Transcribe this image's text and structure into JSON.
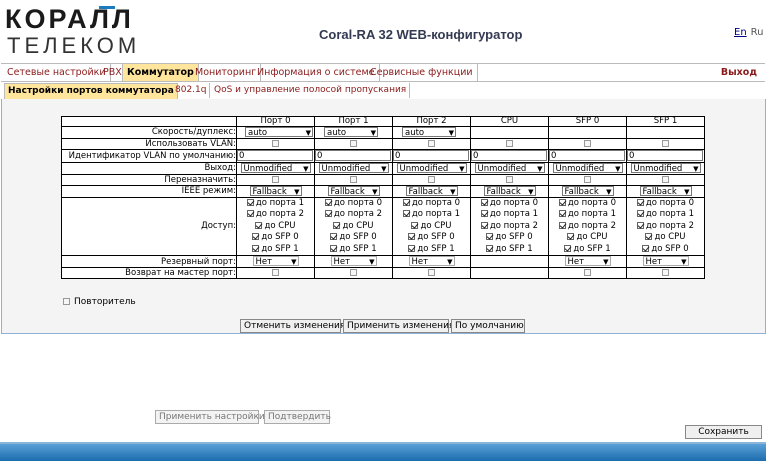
{
  "logo": {
    "line1": "КОРАЛЛ",
    "line2": "ТЕЛЕКОМ"
  },
  "header": {
    "title": "Coral-RA 32 WEB-конфигуратор",
    "lang_en": "En",
    "lang_ru": "Ru"
  },
  "menu": {
    "items": [
      "Сетевые настройки",
      "PBX",
      "Коммутатор",
      "Мониторинг",
      "Информация о системе",
      "Сервисные функции"
    ],
    "exit": "Выход"
  },
  "subtabs": [
    "Настройки портов коммутатора",
    "802.1q",
    "QoS и управление полосой пропускания"
  ],
  "table": {
    "columns": [
      "Порт 0",
      "Порт 1",
      "Порт 2",
      "CPU",
      "SFP 0",
      "SFP 1"
    ],
    "labels": {
      "speed": "Скорость/дуплекс:",
      "use_vlan": "Использовать VLAN:",
      "vlan_id": "Идентификатор VLAN по умолчанию:",
      "egress": "Выход:",
      "reassign": "Переназначить:",
      "ieee": "IEEE режим:",
      "access": "Доступ:",
      "backup": "Резервный порт:",
      "return_master": "Возврат на мастер порт:"
    },
    "speed_values": [
      "auto",
      "auto",
      "auto"
    ],
    "vlan_values": [
      "0",
      "0",
      "0",
      "0",
      "0",
      "0"
    ],
    "egress_values": [
      "Unmodified",
      "Unmodified",
      "Unmodified",
      "Unmodified",
      "Unmodified",
      "Unmodified"
    ],
    "ieee_values": [
      "Fallback",
      "Fallback",
      "Fallback",
      "Fallback",
      "Fallback",
      "Fallback"
    ],
    "access": [
      [
        "до порта 1",
        "до порта 2",
        "до CPU",
        "до SFP 0",
        "до SFP 1"
      ],
      [
        "до порта 0",
        "до порта 2",
        "до CPU",
        "до SFP 0",
        "до SFP 1"
      ],
      [
        "до порта 0",
        "до порта 1",
        "до CPU",
        "до SFP 0",
        "до SFP 1"
      ],
      [
        "до порта 0",
        "до порта 1",
        "до порта 2",
        "до SFP 0",
        "до SFP 1"
      ],
      [
        "до порта 0",
        "до порта 1",
        "до порта 2",
        "до CPU",
        "до SFP 1"
      ],
      [
        "до порта 0",
        "до порта 1",
        "до порта 2",
        "до CPU",
        "до SFP 0"
      ]
    ],
    "backup_values": [
      "Нет",
      "Нет",
      "Нет",
      "Нет",
      "Нет"
    ]
  },
  "repeater_label": "Повторитель",
  "buttons": {
    "cancel": "Отменить изменения",
    "apply": "Применить изменения",
    "defaults": "По умолчанию",
    "apply_settings": "Применить настройки",
    "confirm": "Подтвердить",
    "save": "Сохранить"
  },
  "colors": {
    "menu_active": "#ffe69c",
    "menu_text": "#8a1a1a",
    "footer": "#1b6cae"
  }
}
